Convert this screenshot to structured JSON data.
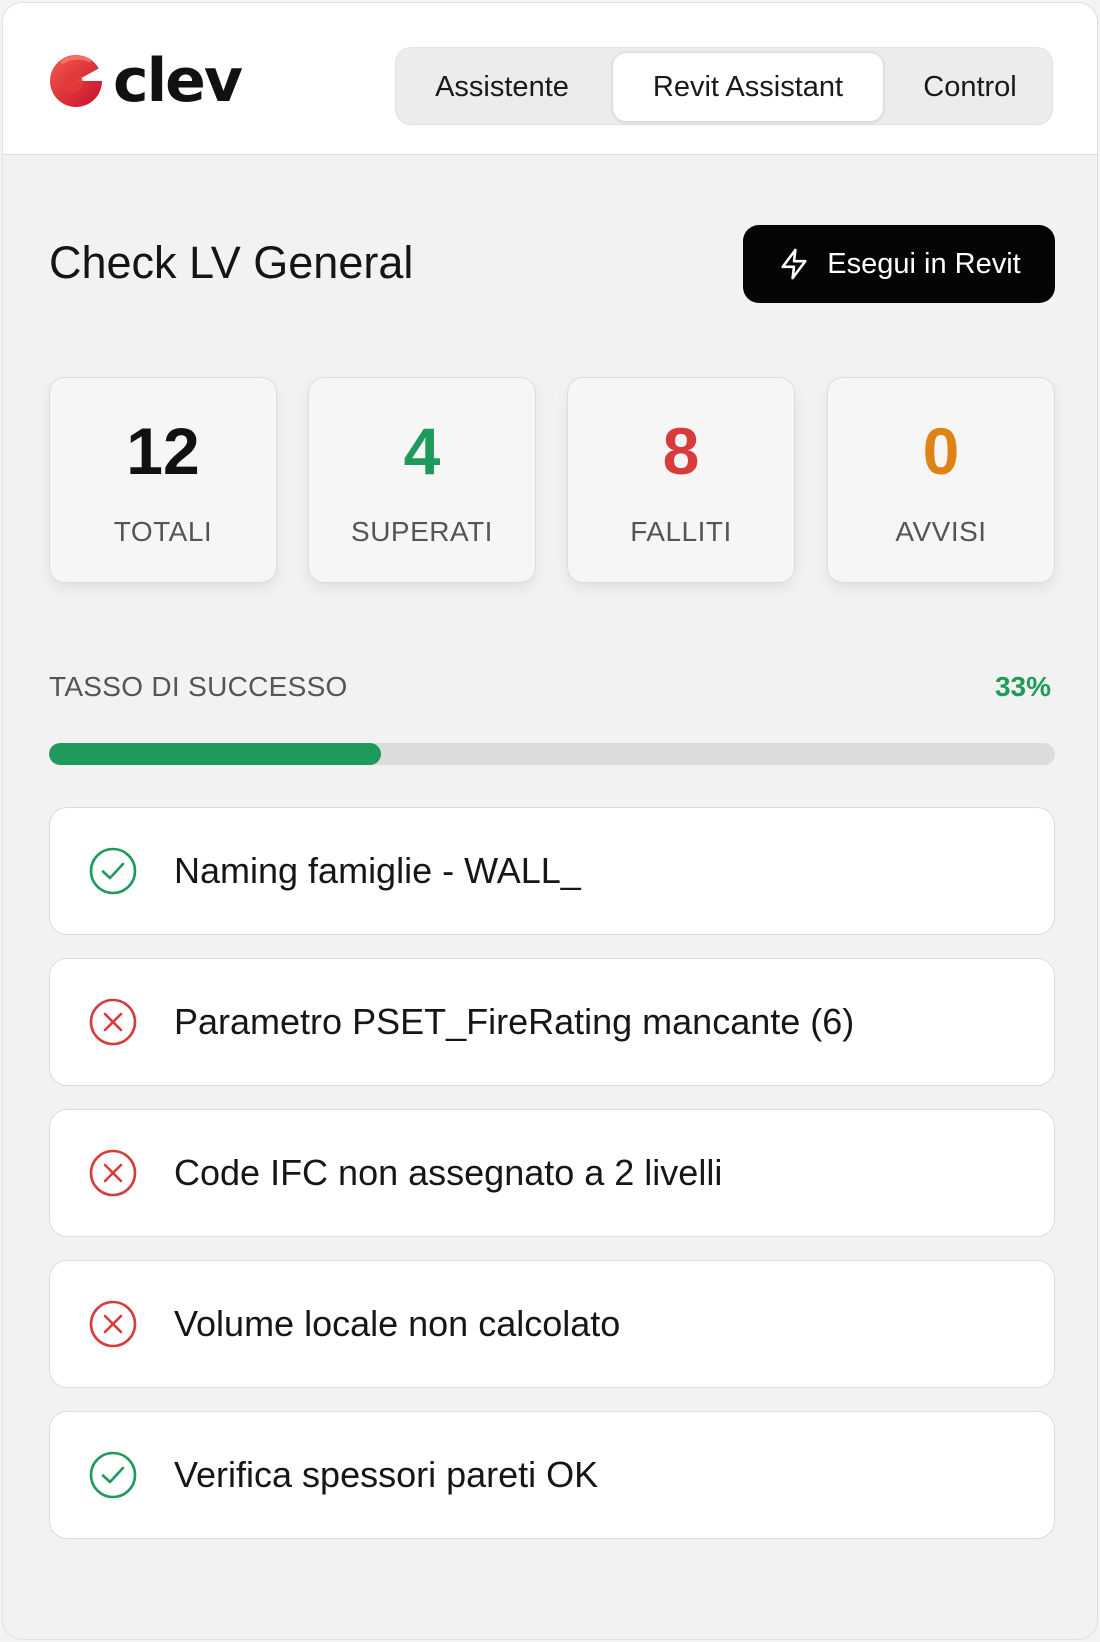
{
  "app": {
    "logo_text": "clev"
  },
  "tabs": [
    {
      "label": "Assistente",
      "active": false
    },
    {
      "label": "Revit Assistant",
      "active": true
    },
    {
      "label": "Control",
      "active": false
    }
  ],
  "page": {
    "title": "Check LV General",
    "run_button_label": "Esegui in Revit"
  },
  "stats": [
    {
      "value": "12",
      "label": "TOTALI",
      "color": "#111111"
    },
    {
      "value": "4",
      "label": "SUPERATI",
      "color": "#1e9a5a"
    },
    {
      "value": "8",
      "label": "FALLITI",
      "color": "#d93a3a"
    },
    {
      "value": "0",
      "label": "AVVISI",
      "color": "#e08316"
    }
  ],
  "success_rate": {
    "label": "TASSO DI SUCCESSO",
    "value_text": "33%",
    "fraction": 0.33
  },
  "checks": [
    {
      "label": "Naming famiglie - WALL_",
      "status": "pass",
      "icon": "check-circle-icon"
    },
    {
      "label": "Parametro PSET_FireRating mancante (6)",
      "status": "fail",
      "icon": "x-circle-icon"
    },
    {
      "label": "Code IFC non assegnato a 2 livelli",
      "status": "fail",
      "icon": "x-circle-icon"
    },
    {
      "label": "Volume locale non calcolato",
      "status": "fail",
      "icon": "x-circle-icon"
    },
    {
      "label": "Verifica spessori pareti OK",
      "status": "pass",
      "icon": "check-circle-icon"
    }
  ],
  "colors": {
    "pass": "#1e9a5a",
    "fail": "#d93a3a",
    "accent_dark": "#050505"
  }
}
